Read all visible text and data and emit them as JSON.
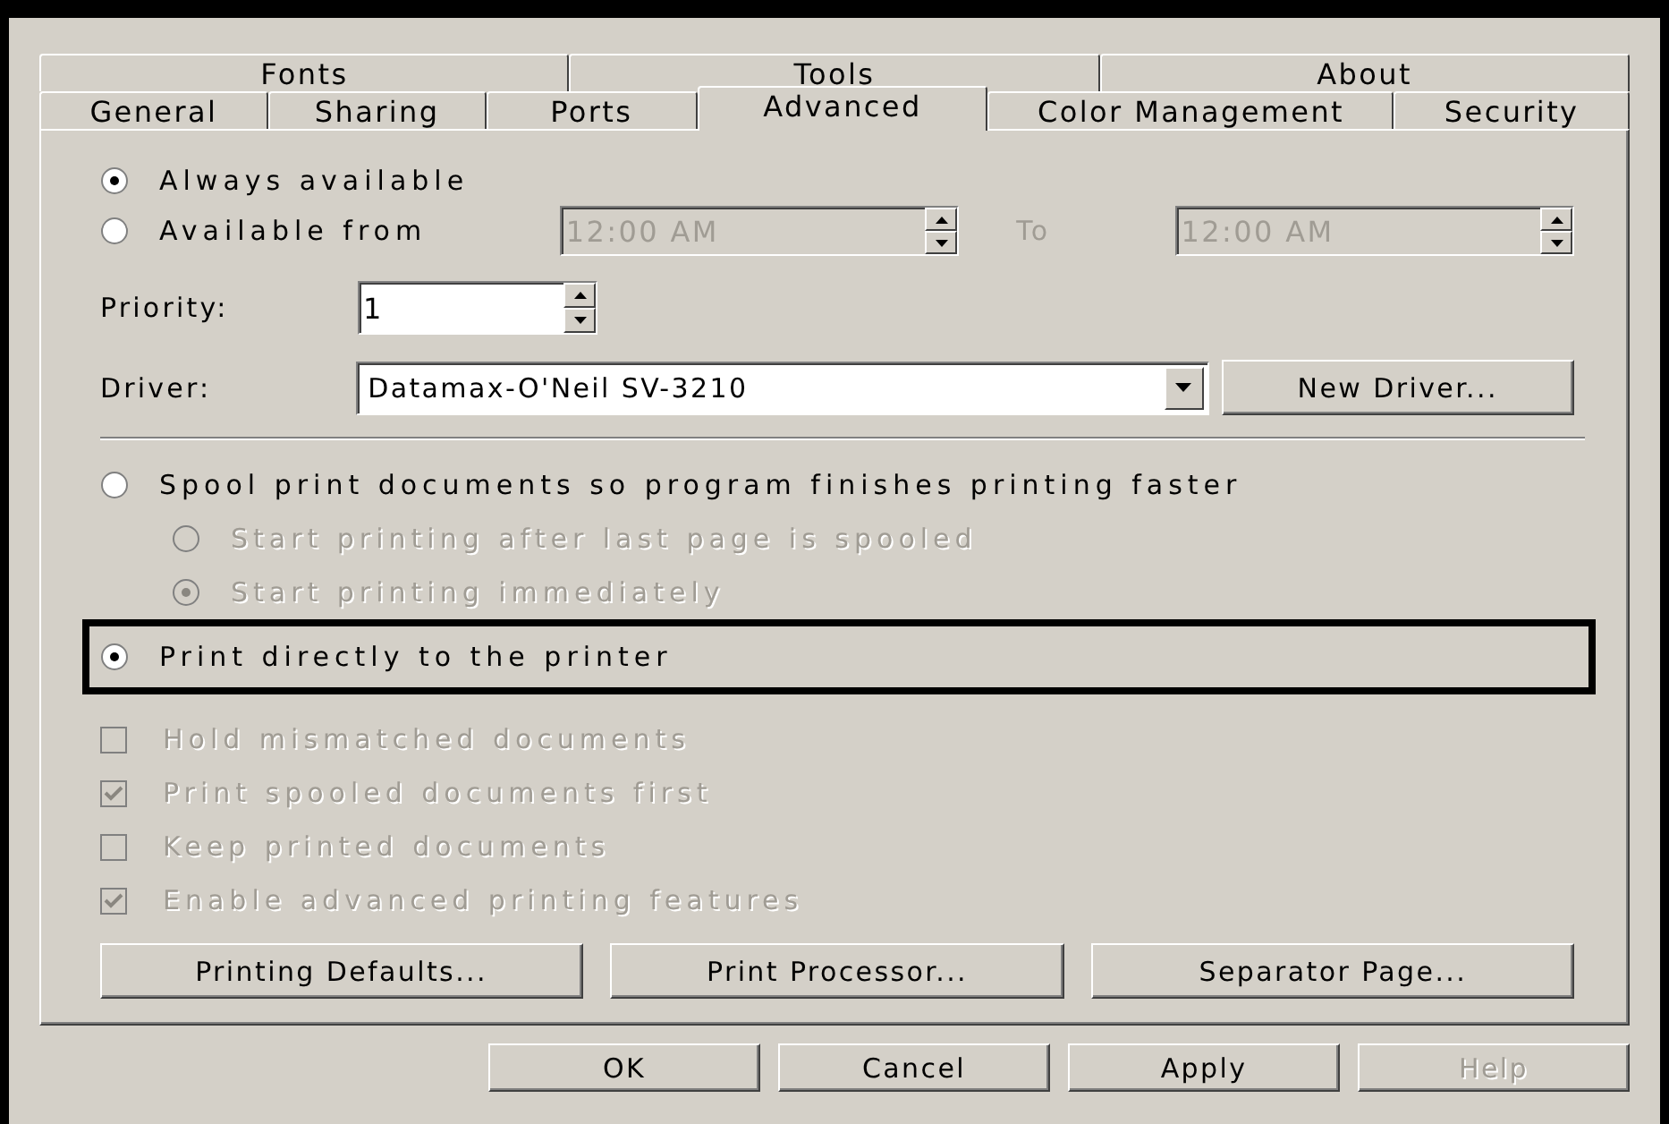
{
  "tab_rows": [
    {
      "tabs": [
        {
          "label": "Fonts",
          "selected": false
        },
        {
          "label": "Tools",
          "selected": false
        },
        {
          "label": "About",
          "selected": false
        }
      ]
    },
    {
      "tabs": [
        {
          "label": "General",
          "selected": false
        },
        {
          "label": "Sharing",
          "selected": false
        },
        {
          "label": "Ports",
          "selected": false
        },
        {
          "label": "Advanced",
          "selected": true
        },
        {
          "label": "Color Management",
          "selected": false
        },
        {
          "label": "Security",
          "selected": false
        }
      ]
    }
  ],
  "availability": [
    {
      "label": "Always available",
      "selected": true
    },
    {
      "label": "Available from",
      "selected": false
    }
  ],
  "from_time": {
    "value": "12:00 AM",
    "disabled": true
  },
  "to_label": "To",
  "to_time": {
    "value": "12:00 AM",
    "disabled": true
  },
  "priority": {
    "label": "Priority:",
    "value": "1"
  },
  "driver": {
    "label": "Driver:",
    "value": "Datamax-O'Neil SV-3210",
    "button": "New Driver..."
  },
  "spooling": [
    {
      "label": "Spool print documents so program finishes printing faster",
      "selected": false,
      "disabled": false,
      "highlighted": false,
      "children": [
        {
          "label": "Start printing after last page is spooled",
          "selected": false,
          "disabled": true
        },
        {
          "label": "Start printing immediately",
          "selected": true,
          "disabled": true
        }
      ]
    },
    {
      "label": "Print directly to the printer",
      "selected": true,
      "disabled": false,
      "highlighted": true
    }
  ],
  "options": [
    {
      "label": "Hold mismatched documents",
      "checked": false,
      "disabled": true
    },
    {
      "label": "Print spooled documents first",
      "checked": true,
      "disabled": true
    },
    {
      "label": "Keep printed documents",
      "checked": false,
      "disabled": true
    },
    {
      "label": "Enable advanced printing features",
      "checked": true,
      "disabled": true
    }
  ],
  "panel_buttons": [
    {
      "label": "Printing Defaults..."
    },
    {
      "label": "Print Processor..."
    },
    {
      "label": "Separator Page..."
    }
  ],
  "footer_buttons": [
    {
      "label": "OK",
      "disabled": false
    },
    {
      "label": "Cancel",
      "disabled": false
    },
    {
      "label": "Apply",
      "disabled": false
    },
    {
      "label": "Help",
      "disabled": true
    }
  ]
}
